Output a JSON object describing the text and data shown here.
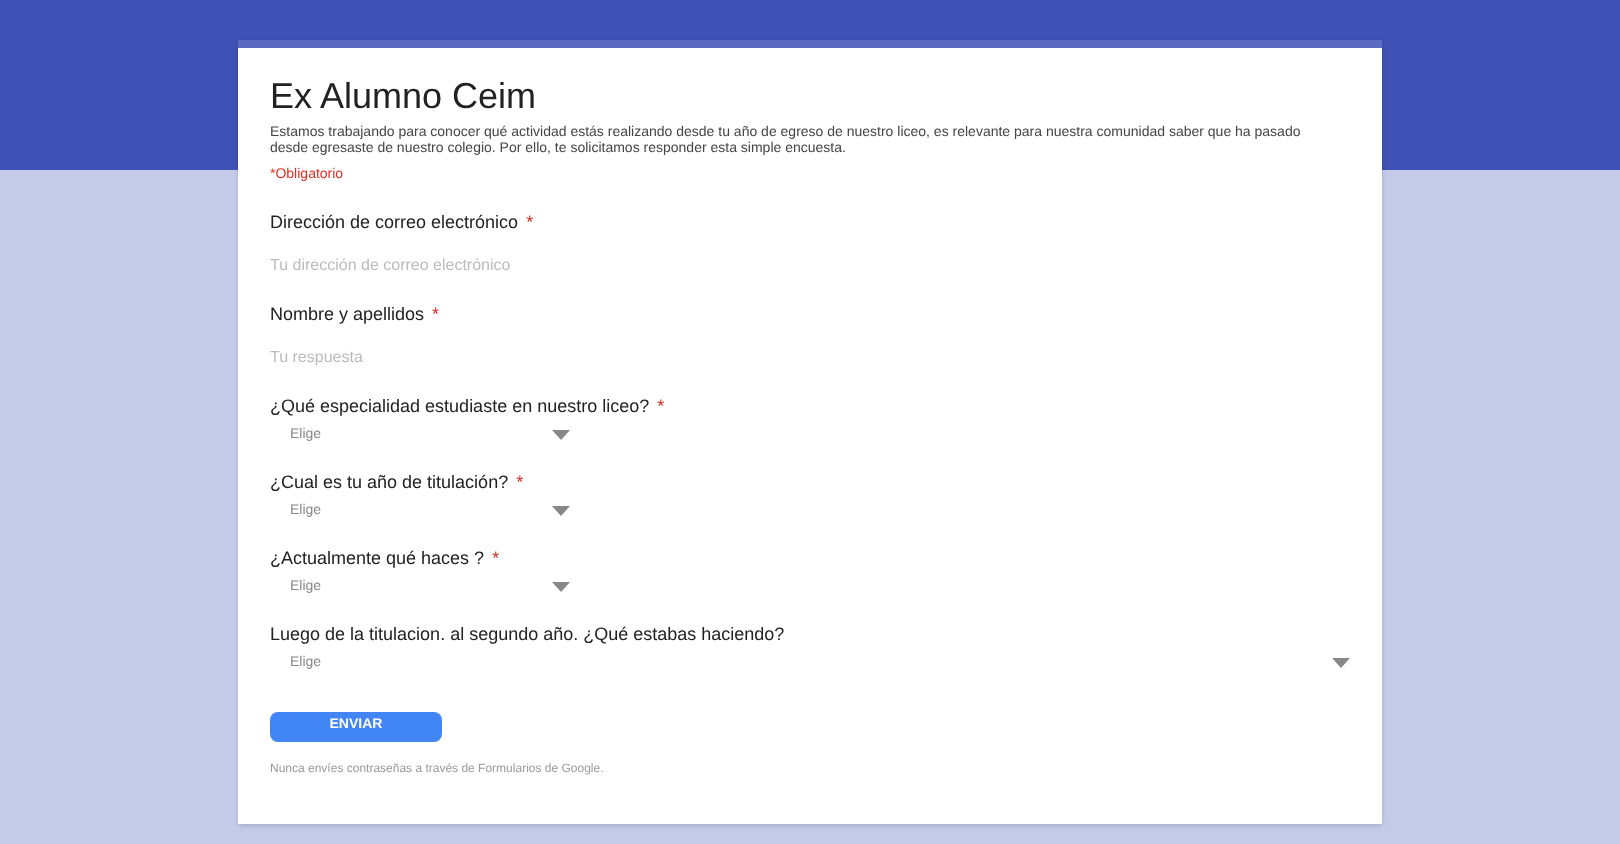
{
  "form": {
    "title": "Ex Alumno Ceim",
    "description": "Estamos trabajando para conocer qué actividad estás realizando desde tu año de egreso de nuestro liceo, es relevante para nuestra comunidad saber que ha pasado desde egresaste de nuestro colegio. Por ello, te solicitamos responder esta simple encuesta.",
    "required_note": "*Obligatorio",
    "questions": [
      {
        "kind": "text",
        "label": "Dirección de correo electrónico",
        "required": true,
        "placeholder": "Tu dirección de correo electrónico"
      },
      {
        "kind": "text",
        "label": "Nombre y apellidos",
        "required": true,
        "placeholder": "Tu respuesta"
      },
      {
        "kind": "select",
        "label": "¿Qué especialidad estudiaste en nuestro liceo?",
        "required": true,
        "placeholder": "Elige"
      },
      {
        "kind": "select",
        "label": "¿Cual es tu año de titulación?",
        "required": true,
        "placeholder": "Elige"
      },
      {
        "kind": "select",
        "label": "¿Actualmente qué haces ?",
        "required": true,
        "placeholder": "Elige"
      },
      {
        "kind": "select",
        "label": "Luego de la titulacion. al segundo año. ¿Qué estabas haciendo?",
        "required": false,
        "placeholder": "Elige"
      }
    ],
    "required_mark": "*",
    "submit": "ENVIAR",
    "footer": "Nunca envíes contraseñas a través de Formularios de Google."
  }
}
